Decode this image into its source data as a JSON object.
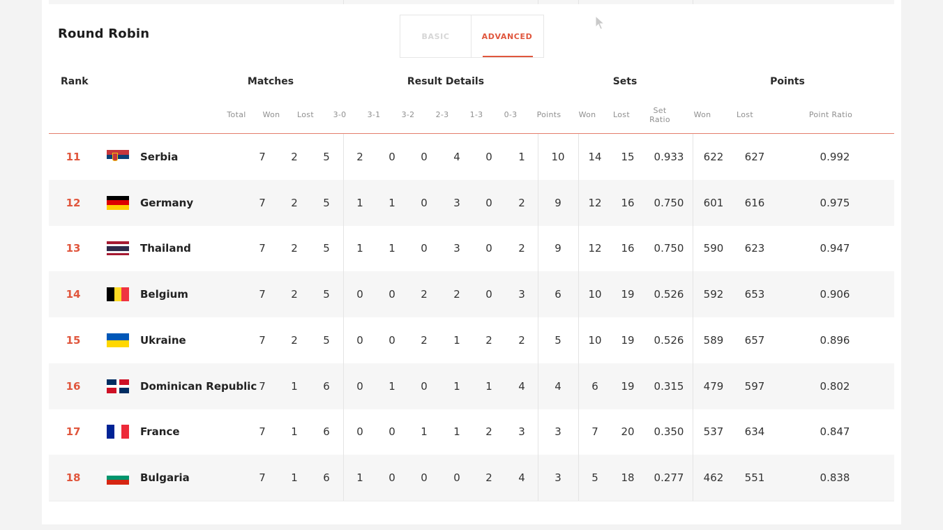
{
  "section_title": "Round Robin",
  "tabs": [
    {
      "label": "BASIC",
      "active": false
    },
    {
      "label": "ADVANCED",
      "active": true
    }
  ],
  "accent_color": "#e0563d",
  "headers": {
    "rank": "Rank",
    "matches": "Matches",
    "result_details": "Result Details",
    "sets": "Sets",
    "points": "Points"
  },
  "sub_headers": {
    "total": "Total",
    "won": "Won",
    "lost": "Lost",
    "r30": "3-0",
    "r31": "3-1",
    "r32": "3-2",
    "r23": "2-3",
    "r13": "1-3",
    "r03": "0-3",
    "points": "Points",
    "sets_won": "Won",
    "sets_lost": "Lost",
    "set_ratio_1": "Set",
    "set_ratio_2": "Ratio",
    "pts_won": "Won",
    "pts_lost": "Lost",
    "point_ratio": "Point Ratio"
  },
  "rows": [
    {
      "rank": "11",
      "team": "Serbia",
      "flag_icon": "serbia-flag-icon",
      "total": "7",
      "won": "2",
      "lost": "5",
      "r30": "2",
      "r31": "0",
      "r32": "0",
      "r23": "4",
      "r13": "0",
      "r03": "1",
      "points": "10",
      "sets_won": "14",
      "sets_lost": "15",
      "set_ratio": "0.933",
      "pts_won": "622",
      "pts_lost": "627",
      "point_ratio": "0.992"
    },
    {
      "rank": "12",
      "team": "Germany",
      "flag_icon": "germany-flag-icon",
      "total": "7",
      "won": "2",
      "lost": "5",
      "r30": "1",
      "r31": "1",
      "r32": "0",
      "r23": "3",
      "r13": "0",
      "r03": "2",
      "points": "9",
      "sets_won": "12",
      "sets_lost": "16",
      "set_ratio": "0.750",
      "pts_won": "601",
      "pts_lost": "616",
      "point_ratio": "0.975"
    },
    {
      "rank": "13",
      "team": "Thailand",
      "flag_icon": "thailand-flag-icon",
      "total": "7",
      "won": "2",
      "lost": "5",
      "r30": "1",
      "r31": "1",
      "r32": "0",
      "r23": "3",
      "r13": "0",
      "r03": "2",
      "points": "9",
      "sets_won": "12",
      "sets_lost": "16",
      "set_ratio": "0.750",
      "pts_won": "590",
      "pts_lost": "623",
      "point_ratio": "0.947"
    },
    {
      "rank": "14",
      "team": "Belgium",
      "flag_icon": "belgium-flag-icon",
      "total": "7",
      "won": "2",
      "lost": "5",
      "r30": "0",
      "r31": "0",
      "r32": "2",
      "r23": "2",
      "r13": "0",
      "r03": "3",
      "points": "6",
      "sets_won": "10",
      "sets_lost": "19",
      "set_ratio": "0.526",
      "pts_won": "592",
      "pts_lost": "653",
      "point_ratio": "0.906"
    },
    {
      "rank": "15",
      "team": "Ukraine",
      "flag_icon": "ukraine-flag-icon",
      "total": "7",
      "won": "2",
      "lost": "5",
      "r30": "0",
      "r31": "0",
      "r32": "2",
      "r23": "1",
      "r13": "2",
      "r03": "2",
      "points": "5",
      "sets_won": "10",
      "sets_lost": "19",
      "set_ratio": "0.526",
      "pts_won": "589",
      "pts_lost": "657",
      "point_ratio": "0.896"
    },
    {
      "rank": "16",
      "team": "Dominican Republic",
      "flag_icon": "dominican-republic-flag-icon",
      "total": "7",
      "won": "1",
      "lost": "6",
      "r30": "0",
      "r31": "1",
      "r32": "0",
      "r23": "1",
      "r13": "1",
      "r03": "4",
      "points": "4",
      "sets_won": "6",
      "sets_lost": "19",
      "set_ratio": "0.315",
      "pts_won": "479",
      "pts_lost": "597",
      "point_ratio": "0.802"
    },
    {
      "rank": "17",
      "team": "France",
      "flag_icon": "france-flag-icon",
      "total": "7",
      "won": "1",
      "lost": "6",
      "r30": "0",
      "r31": "0",
      "r32": "1",
      "r23": "1",
      "r13": "2",
      "r03": "3",
      "points": "3",
      "sets_won": "7",
      "sets_lost": "20",
      "set_ratio": "0.350",
      "pts_won": "537",
      "pts_lost": "634",
      "point_ratio": "0.847"
    },
    {
      "rank": "18",
      "team": "Bulgaria",
      "flag_icon": "bulgaria-flag-icon",
      "total": "7",
      "won": "1",
      "lost": "6",
      "r30": "1",
      "r31": "0",
      "r32": "0",
      "r23": "0",
      "r13": "2",
      "r03": "4",
      "points": "3",
      "sets_won": "5",
      "sets_lost": "18",
      "set_ratio": "0.277",
      "pts_won": "462",
      "pts_lost": "551",
      "point_ratio": "0.838"
    }
  ]
}
